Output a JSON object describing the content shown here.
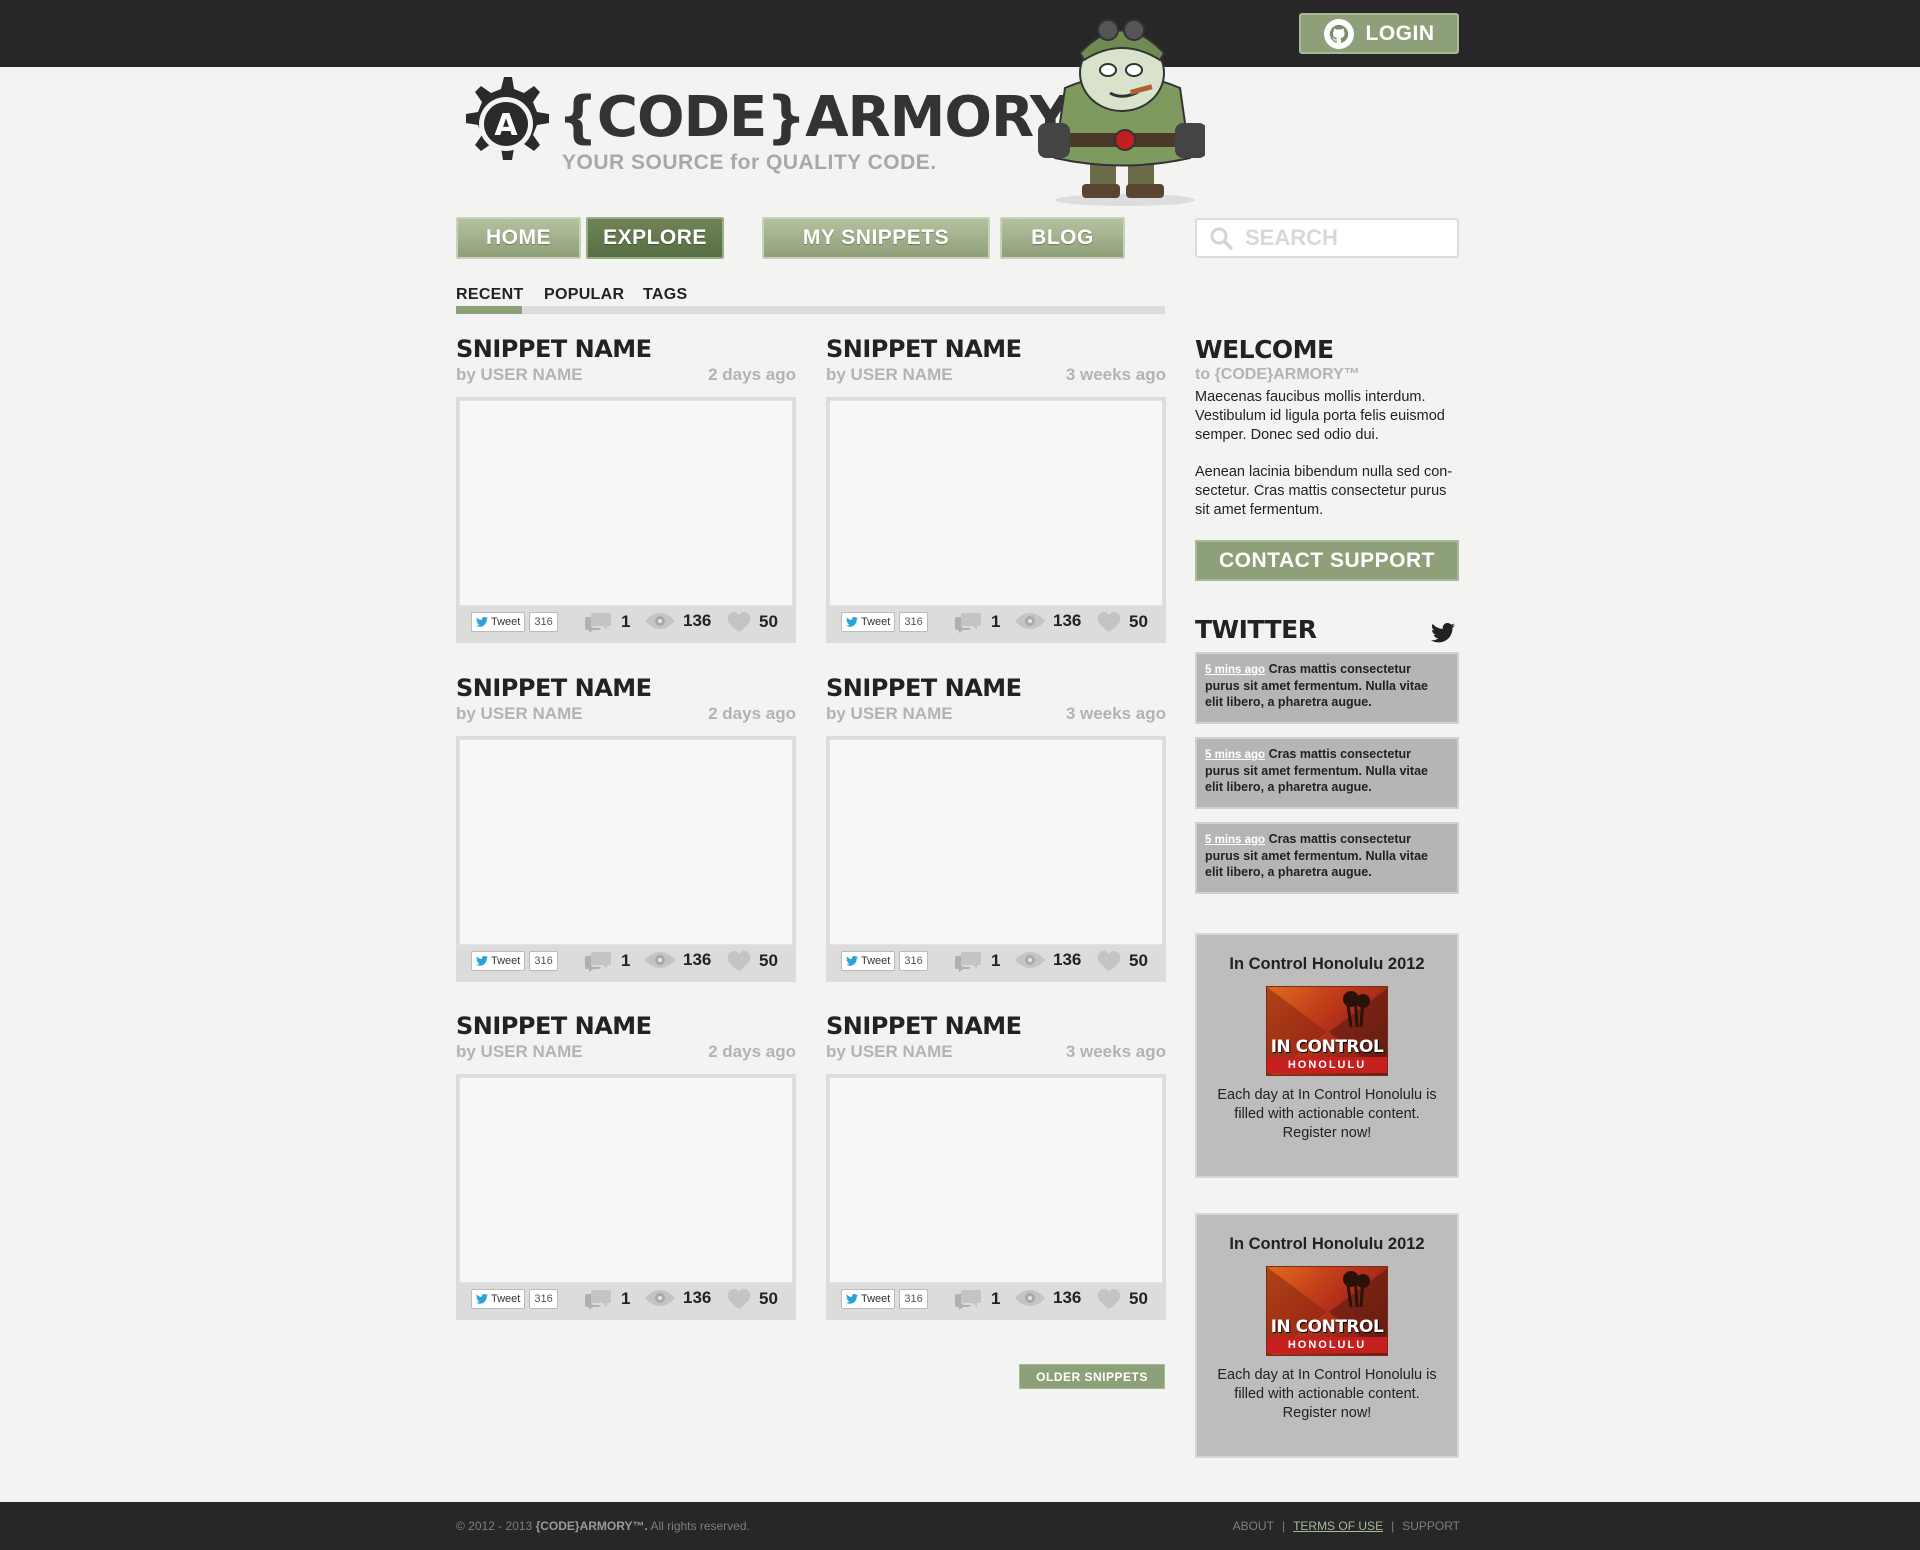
{
  "header": {
    "login_label": "LOGIN",
    "brand": {
      "code": "{CODE}",
      "armory": "ARMORY",
      "tm": "™",
      "tagline": "YOUR SOURCE for QUALITY CODE.",
      "gear_letter": "A"
    }
  },
  "nav": [
    {
      "label": "HOME",
      "active": false
    },
    {
      "label": "EXPLORE",
      "active": true
    },
    {
      "label": "MY SNIPPETS",
      "active": false
    },
    {
      "label": "BLOG",
      "active": false
    }
  ],
  "search": {
    "placeholder": "SEARCH"
  },
  "tabs": [
    {
      "label": "RECENT",
      "active": true
    },
    {
      "label": "POPULAR",
      "active": false
    },
    {
      "label": "TAGS",
      "active": false
    }
  ],
  "snippets": [
    {
      "title": "SNIPPET NAME",
      "author": "by USER NAME",
      "date": "2 days ago",
      "tweet": "Tweet",
      "tweet_count": "316",
      "comments": "1",
      "views": "136",
      "likes": "50"
    },
    {
      "title": "SNIPPET NAME",
      "author": "by USER NAME",
      "date": "3 weeks ago",
      "tweet": "Tweet",
      "tweet_count": "316",
      "comments": "1",
      "views": "136",
      "likes": "50"
    },
    {
      "title": "SNIPPET NAME",
      "author": "by USER NAME",
      "date": "2 days ago",
      "tweet": "Tweet",
      "tweet_count": "316",
      "comments": "1",
      "views": "136",
      "likes": "50"
    },
    {
      "title": "SNIPPET NAME",
      "author": "by USER NAME",
      "date": "3 weeks ago",
      "tweet": "Tweet",
      "tweet_count": "316",
      "comments": "1",
      "views": "136",
      "likes": "50"
    },
    {
      "title": "SNIPPET NAME",
      "author": "by USER NAME",
      "date": "2 days ago",
      "tweet": "Tweet",
      "tweet_count": "316",
      "comments": "1",
      "views": "136",
      "likes": "50"
    },
    {
      "title": "SNIPPET NAME",
      "author": "by USER NAME",
      "date": "3 weeks ago",
      "tweet": "Tweet",
      "tweet_count": "316",
      "comments": "1",
      "views": "136",
      "likes": "50"
    }
  ],
  "older_label": "OLDER SNIPPETS",
  "welcome": {
    "heading": "WELCOME",
    "sub_prefix": "to",
    "sub_brand": "{CODE}ARMORY™",
    "p1": "Maecenas faucibus mollis interdum. Vestibulum id ligula porta felis euismod semper. Donec sed odio dui.",
    "p2": "Aenean lacinia bibendum nulla sed con-sectetur. Cras mattis consectetur purus sit amet fermentum.",
    "button": "CONTACT SUPPORT"
  },
  "twitter": {
    "heading": "TWITTER",
    "tweets": [
      {
        "ago": "5 mins ago",
        "text": "Cras mattis consectetur purus sit amet fermentum. Nulla vitae elit libero, a pharetra augue."
      },
      {
        "ago": "5 mins ago",
        "text": "Cras mattis consectetur purus sit amet fermentum. Nulla vitae elit libero, a pharetra augue."
      },
      {
        "ago": "5 mins ago",
        "text": "Cras mattis consectetur purus sit amet fermentum. Nulla vitae elit libero, a pharetra augue."
      }
    ]
  },
  "ads": [
    {
      "title": "In Control Honolulu 2012",
      "img_line1": "IN CONTROL",
      "img_line2": "HONOLULU",
      "text": "Each day at In Control Honolulu is filled with actionable content. Register now!"
    },
    {
      "title": "In Control Honolulu 2012",
      "img_line1": "IN CONTROL",
      "img_line2": "HONOLULU",
      "text": "Each day at In Control Honolulu is filled with actionable content. Register now!"
    }
  ],
  "footer": {
    "copyright": "© 2012 - 2013",
    "brand": "{CODE}ARMORY™.",
    "rights": "All rights reserved.",
    "links": [
      "ABOUT",
      "TERMS OF USE",
      "SUPPORT"
    ],
    "separator": "|"
  },
  "colors": {
    "accent": "#8ea07a",
    "accent_dark": "#5a6e45",
    "bar": "#272727",
    "background": "#f3f3f1"
  }
}
